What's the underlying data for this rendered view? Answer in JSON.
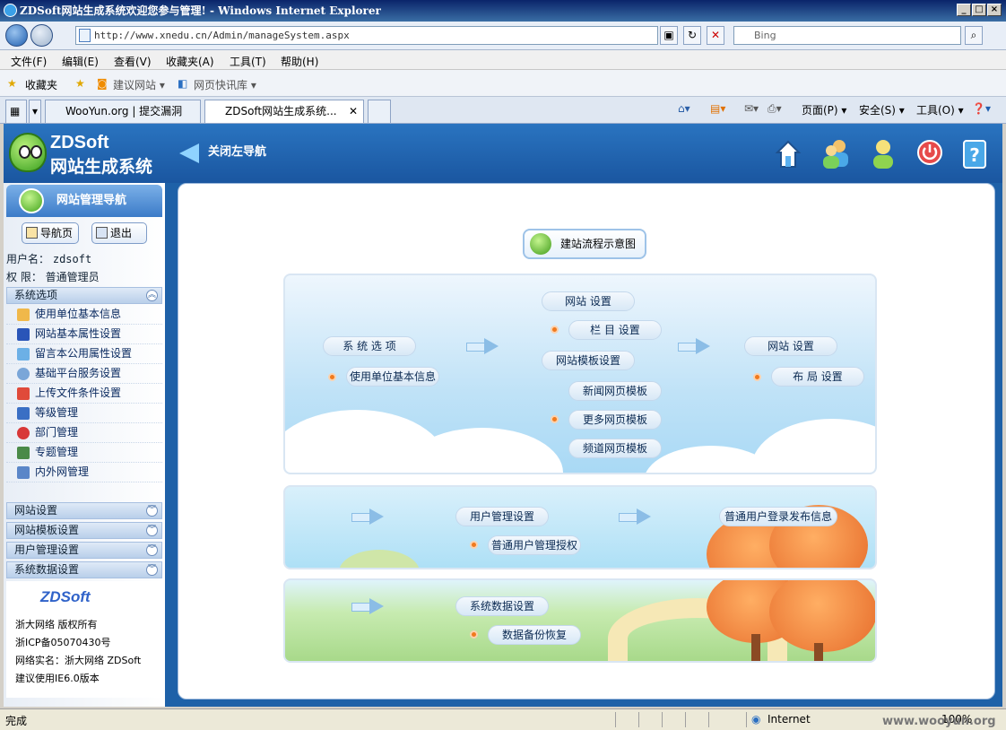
{
  "window": {
    "title": "ZDSoft网站生成系统欢迎您参与管理! - Windows Internet Explorer"
  },
  "browser": {
    "url": "http://www.xnedu.cn/Admin/manageSystem.aspx",
    "search_placeholder": "Bing",
    "menu": [
      "文件(F)",
      "编辑(E)",
      "查看(V)",
      "收藏夹(A)",
      "工具(T)",
      "帮助(H)"
    ],
    "favorites": {
      "label": "收藏夹",
      "suggest": "建议网站 ▾",
      "slices": "网页快讯库 ▾"
    },
    "tabs": [
      {
        "label": "WooYun.org | 提交漏洞"
      },
      {
        "label": "ZDSoft网站生成系统..."
      }
    ],
    "commands": {
      "page": "页面(P) ▾",
      "safety": "安全(S) ▾",
      "tools": "工具(O) ▾"
    }
  },
  "app": {
    "logo_line1": "ZDSoft",
    "logo_line2": "网站生成系统",
    "close_nav": "关闭左导航",
    "sidebar": {
      "title": "网站管理导航",
      "home_button": "导航页",
      "logout_button": "退出",
      "user_label": "用户名：",
      "user_value": "zdsoft",
      "role_label": "权 限：",
      "role_value": "普通管理员",
      "section_main": "系统选项",
      "items": [
        "使用单位基本信息",
        "网站基本属性设置",
        "留言本公用属性设置",
        "基础平台服务设置",
        "上传文件条件设置",
        "等级管理",
        "部门管理",
        "专题管理",
        "内外网管理"
      ],
      "sections": [
        "网站设置",
        "网站模板设置",
        "用户管理设置",
        "系统数据设置"
      ],
      "footer": {
        "brand": "ZDSoft",
        "line1": "浙大网络 版权所有",
        "line2": "浙ICP备05070430号",
        "line3": "网络实名：浙大网络 ZDSoft",
        "line4": "建议使用IE6.0版本"
      }
    },
    "flow": {
      "title": "建站流程示意图",
      "system_options": "系 统 选 项",
      "unit_info": "使用单位基本信息",
      "site_settings_top": "网站 设置",
      "column_settings": "栏 目 设置",
      "template_settings": "网站模板设置",
      "news_template": "新闻网页模板",
      "more_template": "更多网页模板",
      "channel_template": "频道网页模板",
      "site_settings_right": "网站 设置",
      "layout_settings": "布 局 设置",
      "user_mgmt": "用户管理设置",
      "user_auth": "普通用户管理授权",
      "user_publish": "普通用户登录发布信息",
      "sys_data": "系统数据设置",
      "backup": "数据备份恢复"
    }
  },
  "status": {
    "text": "完成",
    "zone": "Internet",
    "zoom": "100%",
    "watermark": "www.wooyun.org"
  }
}
